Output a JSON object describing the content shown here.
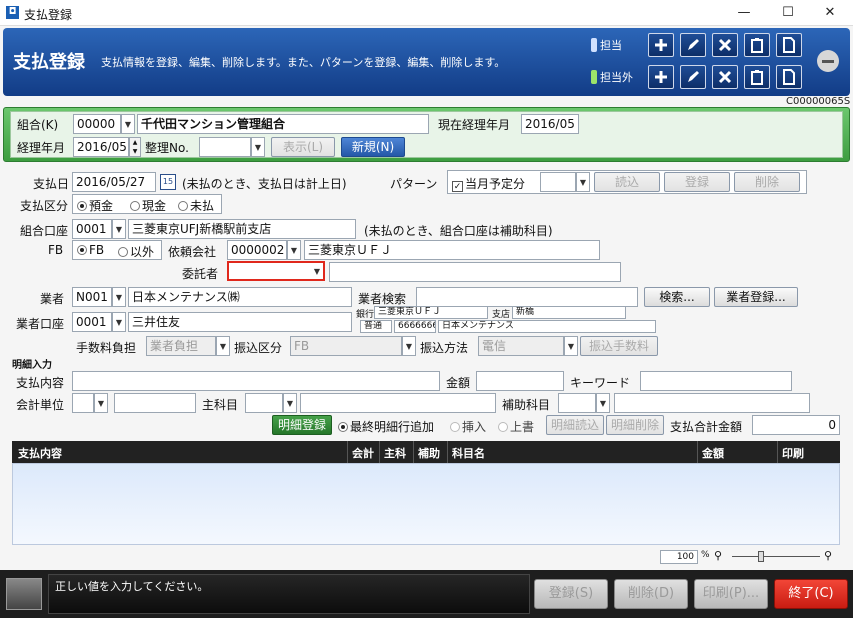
{
  "window": {
    "title": "支払登録",
    "minimize": "—",
    "maximize": "☐",
    "close": "✕"
  },
  "header": {
    "title": "支払登録",
    "description": "支払情報を登録、編集、削除します。また、パターンを登録、編集、削除します。",
    "role_in": "担当",
    "role_out": "担当外",
    "code": "C00000065S"
  },
  "association": {
    "label": "組合(K)",
    "code": "00000",
    "name": "千代田マンション管理組合",
    "current_month_label": "現在経理年月",
    "current_month": "2016/05",
    "accounting_month_label": "経理年月",
    "accounting_month": "2016/05",
    "seiri_label": "整理No.",
    "seiri_value": "",
    "show_button": "表示(L)",
    "new_button": "新規(N)"
  },
  "payment": {
    "date_label": "支払日",
    "date": "2016/05/27",
    "date_note": "(未払のとき、支払日は計上日)",
    "pattern_label": "パターン",
    "monthly_scheduled": "当月予定分",
    "pattern_value": "",
    "read_button": "読込",
    "register_button": "登録",
    "delete_button": "削除",
    "type_label": "支払区分",
    "type_options": [
      "預金",
      "現金",
      "未払"
    ],
    "account_label": "組合口座",
    "account_code": "0001",
    "account_name": "三菱東京UFJ新橋駅前支店",
    "account_note": "(未払のとき、組合口座は補助科目)",
    "fb_label": "FB",
    "fb_options": [
      "FB",
      "以外"
    ],
    "client_label": "依頼会社",
    "client_code": "0000002",
    "client_name": "三菱東京ＵＦＪ",
    "consignor_label": "委託者",
    "consignor_value": "",
    "consignor_name": "",
    "vendor_label": "業者",
    "vendor_code": "N001",
    "vendor_name": "日本メンテナンス㈱",
    "vendor_search_label": "業者検索",
    "vendor_search_value": "",
    "search_button": "検索...",
    "vendor_register_button": "業者登録...",
    "vendor_account_label": "業者口座",
    "vendor_account_code": "0001",
    "vendor_account_name": "三井住友",
    "bank_label": "銀行",
    "bank_name": "三菱東京ＵＦＪ",
    "branch_label": "支店",
    "branch_name": "新橋",
    "account_type": "普通",
    "account_number": "6666666",
    "account_holder": "日本メンテナンス",
    "fee_label": "手数料負担",
    "fee_value": "業者負担",
    "transfer_type_label": "振込区分",
    "transfer_type_value": "FB",
    "transfer_method_label": "振込方法",
    "transfer_method_value": "電信",
    "transfer_fee_button": "振込手数料"
  },
  "detail": {
    "section_label": "明細入力",
    "content_label": "支払内容",
    "content_value": "",
    "amount_label": "金額",
    "amount_value": "",
    "keyword_label": "キーワード",
    "keyword_value": "",
    "unit_label": "会計単位",
    "main_account_label": "主科目",
    "sub_account_label": "補助科目",
    "detail_register_button": "明細登録",
    "insert_options": [
      "最終明細行追加",
      "挿入",
      "上書"
    ],
    "detail_read_button": "明細読込",
    "detail_delete_button": "明細削除",
    "total_label": "支払合計金額",
    "total_value": "0"
  },
  "grid": {
    "columns": [
      "支払内容",
      "会計",
      "主科",
      "補助",
      "科目名",
      "金額",
      "印刷"
    ],
    "zoom": "100",
    "zoom_unit": "%"
  },
  "status": {
    "message": "正しい値を入力してください。"
  },
  "footer": {
    "register": "登録(S)",
    "delete": "削除(D)",
    "print": "印刷(P)...",
    "exit": "終了(C)"
  },
  "colors": {
    "header": "#1b4a98",
    "green_panel": "#4fae52",
    "exit_button": "#e0281c",
    "consignor_highlight": "#e0281c"
  }
}
